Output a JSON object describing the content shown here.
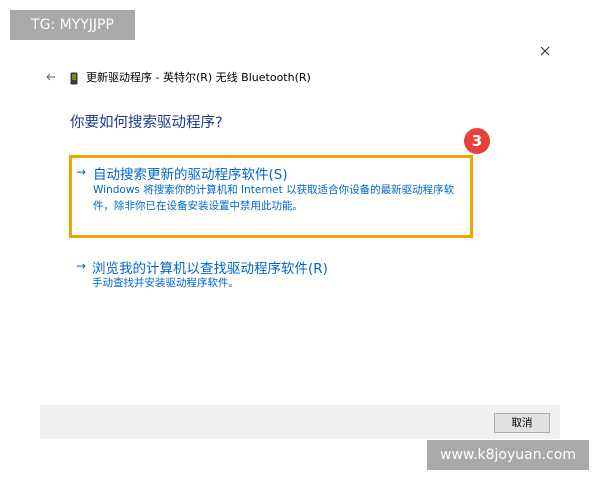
{
  "watermarks": {
    "top": "TG: MYYJJPP",
    "bottom": "www.k8joyuan.com"
  },
  "window": {
    "title": "更新驱动程序 - 英特尔(R) 无线 Bluetooth(R)",
    "back_icon": "←",
    "close_icon": "×"
  },
  "dialog": {
    "heading": "你要如何搜索驱动程序?"
  },
  "options": [
    {
      "arrow": "→",
      "title": "自动搜索更新的驱动程序软件(S)",
      "description": "Windows 将搜索你的计算机和 Internet 以获取适合你设备的最新驱动程序软件，除非你已在设备安装设置中禁用此功能。",
      "highlighted": true
    },
    {
      "arrow": "→",
      "title": "浏览我的计算机以查找驱动程序软件(R)",
      "description": "手动查找并安装驱动程序软件。",
      "highlighted": false
    }
  ],
  "annotation": {
    "step_number": "3",
    "color": "#e8413c",
    "highlight_color": "#f0a500"
  },
  "footer": {
    "cancel_label": "取消"
  }
}
